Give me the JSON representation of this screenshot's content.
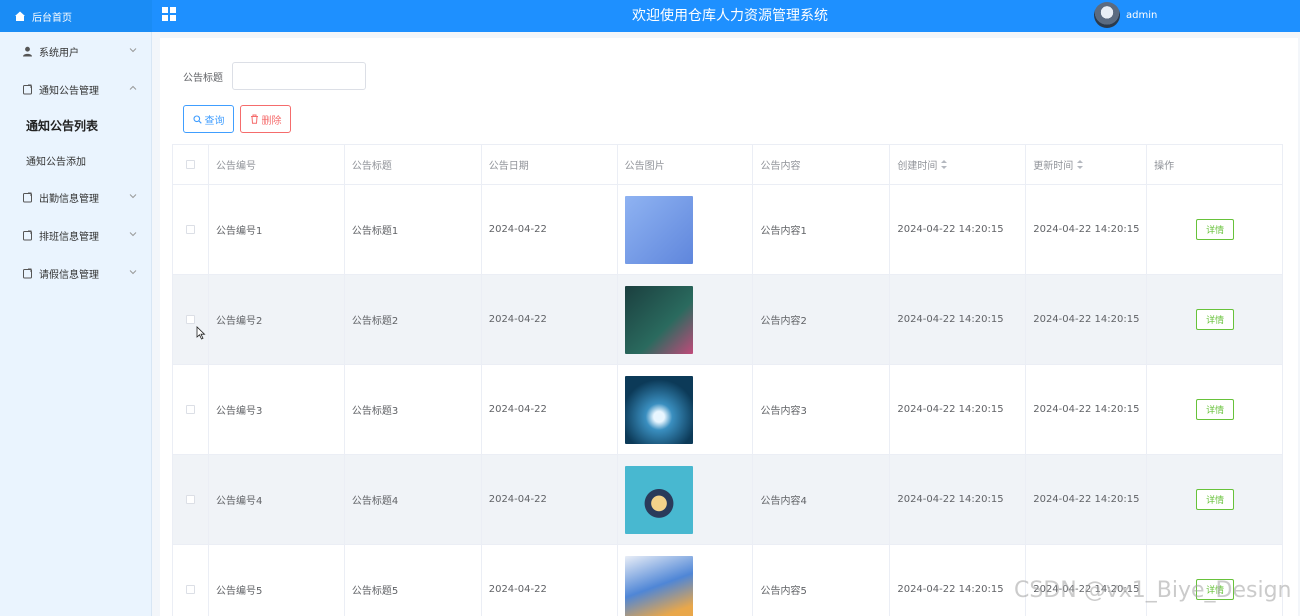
{
  "header": {
    "brand": "后台首页",
    "title": "欢迎使用仓库人力资源管理系统",
    "user": "admin",
    "color": "#1e90ff"
  },
  "sidebar": {
    "items": [
      {
        "label": "系统用户",
        "icon": "user-icon",
        "expanded": false
      },
      {
        "label": "通知公告管理",
        "icon": "doc-icon",
        "expanded": true,
        "children": [
          {
            "label": "通知公告列表",
            "active": true
          },
          {
            "label": "通知公告添加",
            "active": false
          }
        ]
      },
      {
        "label": "出勤信息管理",
        "icon": "doc-icon",
        "expanded": false
      },
      {
        "label": "排班信息管理",
        "icon": "doc-icon",
        "expanded": false
      },
      {
        "label": "请假信息管理",
        "icon": "doc-icon",
        "expanded": false
      }
    ]
  },
  "search": {
    "label": "公告标题",
    "value": "",
    "query_label": "查询",
    "delete_label": "删除"
  },
  "table": {
    "columns": [
      "公告编号",
      "公告标题",
      "公告日期",
      "公告图片",
      "公告内容",
      "创建时间",
      "更新时间",
      "操作"
    ],
    "rows": [
      {
        "id": "公告编号1",
        "title": "公告标题1",
        "date": "2024-04-22",
        "content": "公告内容1",
        "created": "2024-04-22 14:20:15",
        "updated": "2024-04-22 14:20:15",
        "action": "详情",
        "thumb": "#7a9ee8"
      },
      {
        "id": "公告编号2",
        "title": "公告标题2",
        "date": "2024-04-22",
        "content": "公告内容2",
        "created": "2024-04-22 14:20:15",
        "updated": "2024-04-22 14:20:15",
        "action": "详情",
        "thumb": "#1f4a4e"
      },
      {
        "id": "公告编号3",
        "title": "公告标题3",
        "date": "2024-04-22",
        "content": "公告内容3",
        "created": "2024-04-22 14:20:15",
        "updated": "2024-04-22 14:20:15",
        "action": "详情",
        "thumb": "#0f4e6c"
      },
      {
        "id": "公告编号4",
        "title": "公告标题4",
        "date": "2024-04-22",
        "content": "公告内容4",
        "created": "2024-04-22 14:20:15",
        "updated": "2024-04-22 14:20:15",
        "action": "详情",
        "thumb": "#3bb0c9"
      },
      {
        "id": "公告编号5",
        "title": "公告标题5",
        "date": "2024-04-22",
        "content": "公告内容5",
        "created": "2024-04-22 14:20:15",
        "updated": "2024-04-22 14:20:15",
        "action": "详情",
        "thumb": "#4f86d6"
      }
    ]
  },
  "watermark": "CSDN @vx1_Biye_Design"
}
